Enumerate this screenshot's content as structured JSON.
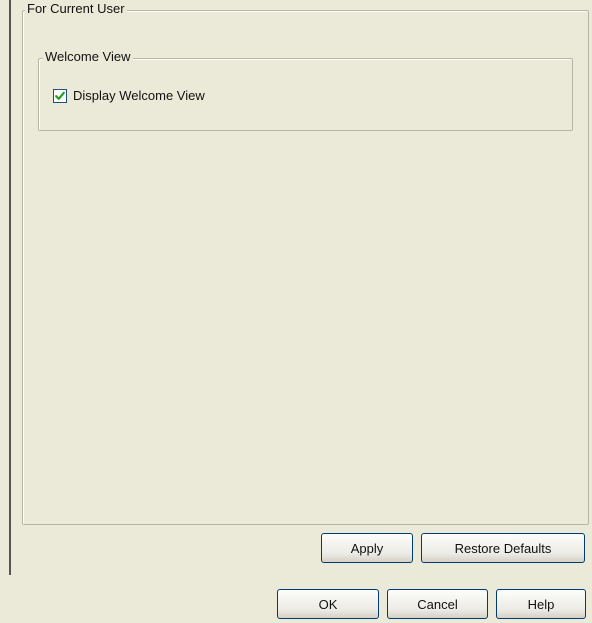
{
  "panel": {
    "group_title": "For Current User",
    "welcome_view": {
      "title": "Welcome View",
      "checkbox_label": "Display Welcome View",
      "checked": true
    }
  },
  "panel_buttons": {
    "apply_label": "Apply",
    "restore_label": "Restore Defaults"
  },
  "dialog_buttons": {
    "ok_label": "OK",
    "cancel_label": "Cancel",
    "help_label": "Help"
  },
  "colors": {
    "background": "#ebe9d8",
    "checkmark": "#21a121",
    "button_border": "#003c74"
  },
  "icons": {
    "checkbox": "check-mark"
  }
}
